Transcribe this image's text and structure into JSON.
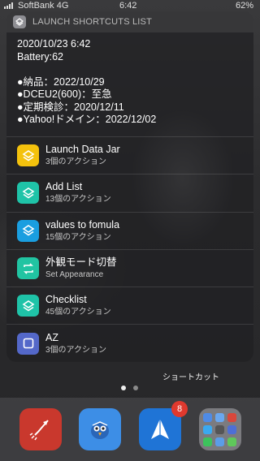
{
  "status_bar": {
    "carrier": "SoftBank 4G",
    "time": "6:42",
    "battery": "62%"
  },
  "widget": {
    "title": "LAUNCH SHORTCUTS LIST",
    "info_lines": [
      "2020/10/23 6:42",
      "Battery:62",
      "",
      "●納品：2022/10/29",
      "●DCEU2(600)：至急",
      "●定期検診：2020/12/11",
      "●Yahoo!ドメイン：2022/12/02"
    ],
    "shortcuts": [
      {
        "name": "Launch Data Jar",
        "subtitle": "3個のアクション",
        "icon": "layers-icon",
        "color": "#f4c20d"
      },
      {
        "name": "Add List",
        "subtitle": "13個のアクション",
        "icon": "layers-icon",
        "color": "#1fc3a8"
      },
      {
        "name": "values to fomula",
        "subtitle": "15個のアクション",
        "icon": "layers-icon",
        "color": "#1a9ee0"
      },
      {
        "name": "外観モード切替",
        "subtitle": "Set Appearance",
        "icon": "cycle-arrows-icon",
        "color": "#21c4a2"
      },
      {
        "name": "Checklist",
        "subtitle": "45個のアクション",
        "icon": "layers-icon",
        "color": "#1fc3a8"
      },
      {
        "name": "AZ",
        "subtitle": "3個のアクション",
        "icon": "square-icon",
        "color": "#5468c9"
      }
    ]
  },
  "home": {
    "label": "ショートカット"
  },
  "dock": {
    "apps": [
      {
        "icon": "rocket-icon",
        "color": "#c9382d"
      },
      {
        "icon": "bird-icon",
        "color": "#3d8ee6"
      },
      {
        "icon": "paper-plane-icon",
        "color": "#1f74d6",
        "badge": "8"
      },
      {
        "icon": "folder-icon",
        "color": "#9a9aa0"
      }
    ]
  }
}
